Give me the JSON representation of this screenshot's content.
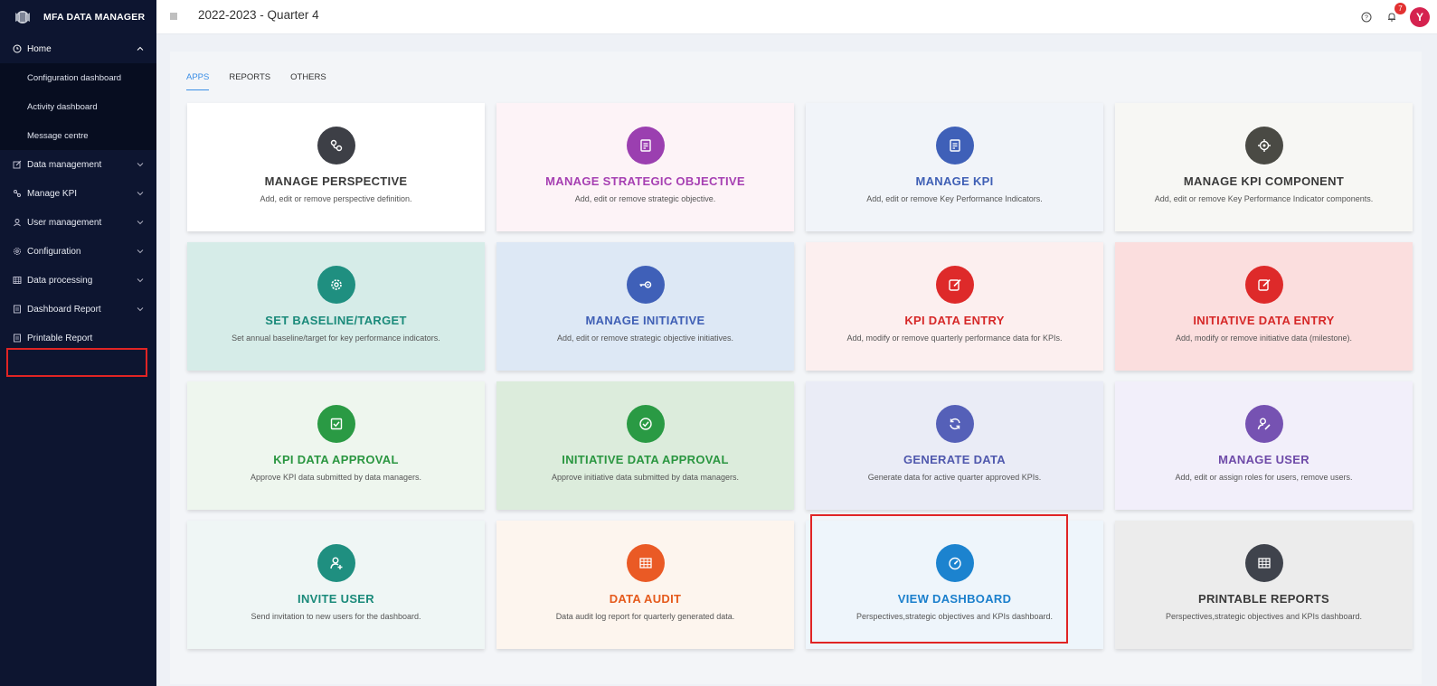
{
  "app": {
    "name": "MFA DATA MANAGER"
  },
  "header": {
    "title": "2022-2023 - Quarter 4",
    "notification_count": "7",
    "avatar_letter": "Y"
  },
  "sidebar": {
    "home": "Home",
    "home_sub": [
      "Configuration dashboard",
      "Activity dashboard",
      "Message centre"
    ],
    "items": [
      {
        "label": "Data management",
        "icon": "edit-icon"
      },
      {
        "label": "Manage KPI",
        "icon": "route-icon"
      },
      {
        "label": "User management",
        "icon": "user-icon"
      },
      {
        "label": "Configuration",
        "icon": "gear-icon"
      },
      {
        "label": "Data processing",
        "icon": "table-icon"
      },
      {
        "label": "Dashboard Report",
        "icon": "report-icon"
      },
      {
        "label": "Printable Report",
        "icon": "report-icon"
      }
    ]
  },
  "tabs": [
    "APPS",
    "REPORTS",
    "OTHERS"
  ],
  "cards": [
    {
      "title": "MANAGE PERSPECTIVE",
      "desc": "Add, edit or remove perspective definition.",
      "icon": "route-icon",
      "color": "#3d3f46",
      "bg": "#ffffff",
      "title_color": "#3a3a3a"
    },
    {
      "title": "MANAGE STRATEGIC OBJECTIVE",
      "desc": "Add, edit or remove strategic objective.",
      "icon": "document-icon",
      "color": "#9b3fb0",
      "bg": "#fdf3f7",
      "title_color": "#a63fb2"
    },
    {
      "title": "MANAGE KPI",
      "desc": "Add, edit or remove Key Performance Indicators.",
      "icon": "document-icon",
      "color": "#3f60b8",
      "bg": "#f1f4f9",
      "title_color": "#3f5fb5"
    },
    {
      "title": "MANAGE KPI COMPONENT",
      "desc": "Add, edit or remove Key Performance Indicator components.",
      "icon": "target-icon",
      "color": "#4a4a44",
      "bg": "#f7f7f4",
      "title_color": "#3a3a3a"
    },
    {
      "title": "SET BASELINE/TARGET",
      "desc": "Set annual baseline/target for key performance indicators.",
      "icon": "gear-icon",
      "color": "#1f8f80",
      "bg": "#d6ece8",
      "title_color": "#1a8a7a"
    },
    {
      "title": "MANAGE INITIATIVE",
      "desc": "Add, edit or remove strategic objective initiatives.",
      "icon": "key-icon",
      "color": "#3f60b8",
      "bg": "#dde8f5",
      "title_color": "#3f5fb5"
    },
    {
      "title": "KPI DATA ENTRY",
      "desc": "Add, modify or remove quarterly performance data for KPIs.",
      "icon": "edit-icon",
      "color": "#de2a2a",
      "bg": "#fcefef",
      "title_color": "#d62828"
    },
    {
      "title": "INITIATIVE DATA ENTRY",
      "desc": "Add, modify or remove initiative data (milestone).",
      "icon": "edit-icon",
      "color": "#de2a2a",
      "bg": "#fbdede",
      "title_color": "#d62828"
    },
    {
      "title": "KPI DATA APPROVAL",
      "desc": "Approve KPI data submitted by data managers.",
      "icon": "check-square-icon",
      "color": "#2a9a44",
      "bg": "#eef6ee",
      "title_color": "#2a9640"
    },
    {
      "title": "INITIATIVE DATA APPROVAL",
      "desc": "Approve initiative data submitted by data managers.",
      "icon": "check-circle-icon",
      "color": "#2a9a44",
      "bg": "#dcecdc",
      "title_color": "#2a9640"
    },
    {
      "title": "GENERATE DATA",
      "desc": "Generate data for active quarter approved KPIs.",
      "icon": "refresh-icon",
      "color": "#5560b8",
      "bg": "#eaecf6",
      "title_color": "#4f58ad"
    },
    {
      "title": "MANAGE USER",
      "desc": "Add, edit or assign roles for users, remove users.",
      "icon": "user-edit-icon",
      "color": "#7652b2",
      "bg": "#f2effa",
      "title_color": "#6e4aa8"
    },
    {
      "title": "INVITE USER",
      "desc": "Send invitation to new users for the dashboard.",
      "icon": "user-add-icon",
      "color": "#1f8f80",
      "bg": "#eff6f5",
      "title_color": "#1a8a7a"
    },
    {
      "title": "DATA AUDIT",
      "desc": "Data audit log report for quarterly generated data.",
      "icon": "table-icon",
      "color": "#ea5a25",
      "bg": "#fdf5ee",
      "title_color": "#e55a1c"
    },
    {
      "title": "VIEW DASHBOARD",
      "desc": "Perspectives,strategic objectives and KPIs dashboard.",
      "icon": "gauge-icon",
      "color": "#1c83cf",
      "bg": "#eef5fb",
      "title_color": "#1a7fcc"
    },
    {
      "title": "PRINTABLE REPORTS",
      "desc": "Perspectives,strategic objectives and KPIs dashboard.",
      "icon": "table-icon",
      "color": "#3f434c",
      "bg": "#ececec",
      "title_color": "#3a3a3a"
    }
  ]
}
